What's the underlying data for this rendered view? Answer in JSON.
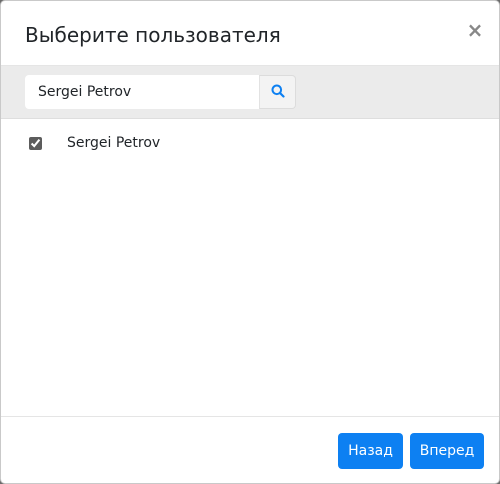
{
  "dialog": {
    "title": "Выберите пользователя",
    "close_label": "×"
  },
  "search": {
    "value": "Sergei Petrov",
    "icon": "search-icon"
  },
  "users": [
    {
      "name": "Sergei Petrov",
      "checked": true
    }
  ],
  "footer": {
    "back_label": "Назад",
    "next_label": "Вперед"
  },
  "colors": {
    "primary": "#0d80f2",
    "search_bar_bg": "#ebebeb",
    "search_icon": "#0d80f2"
  }
}
